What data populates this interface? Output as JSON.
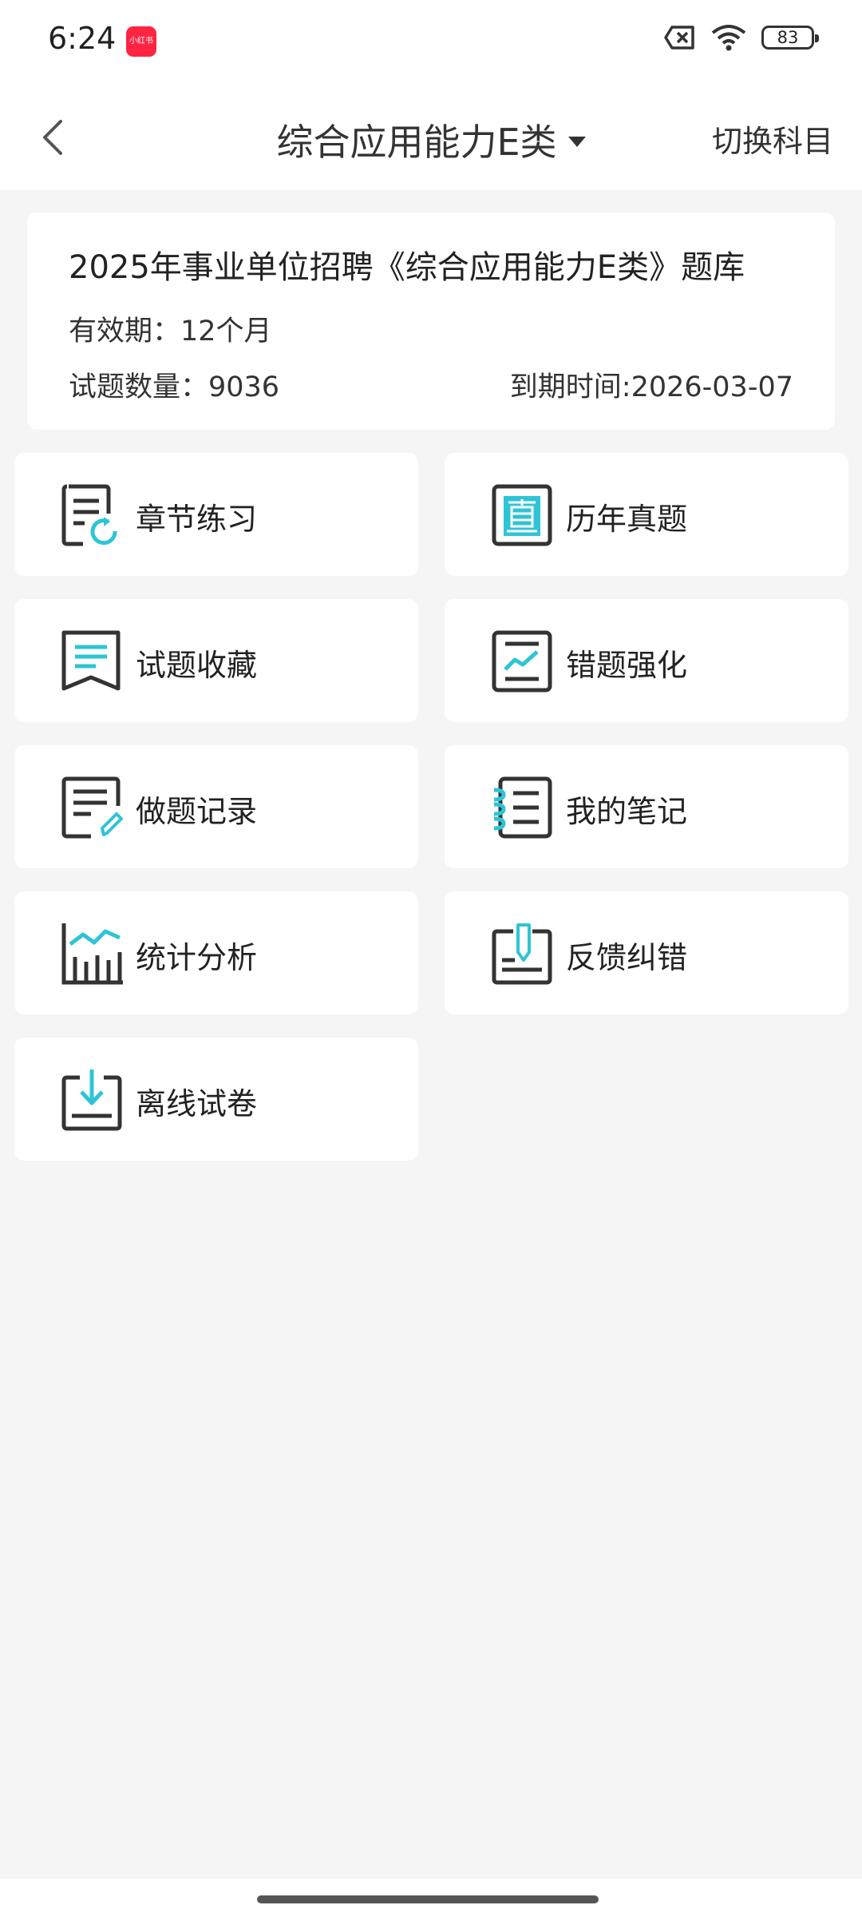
{
  "status_bar": {
    "time": "6:24",
    "app_badge": "小红书",
    "battery": "83"
  },
  "header": {
    "title": "综合应用能力E类",
    "switch_label": "切换科目"
  },
  "info": {
    "bank_title": "2025年事业单位招聘《综合应用能力E类》题库",
    "validity": "有效期：12个月",
    "count": "试题数量：9036",
    "expire": "到期时间:2026-03-07"
  },
  "menu": [
    {
      "label": "章节练习",
      "icon": "chapter-practice-icon"
    },
    {
      "label": "历年真题",
      "icon": "past-papers-icon"
    },
    {
      "label": "试题收藏",
      "icon": "bookmark-icon"
    },
    {
      "label": "错题强化",
      "icon": "wrong-questions-icon"
    },
    {
      "label": "做题记录",
      "icon": "record-icon"
    },
    {
      "label": "我的笔记",
      "icon": "notebook-icon"
    },
    {
      "label": "统计分析",
      "icon": "statistics-icon"
    },
    {
      "label": "反馈纠错",
      "icon": "feedback-icon"
    },
    {
      "label": "离线试卷",
      "icon": "download-icon"
    }
  ],
  "colors": {
    "accent": "#2ec4d6",
    "icon_dark": "#333333",
    "background": "#f5f5f5"
  }
}
